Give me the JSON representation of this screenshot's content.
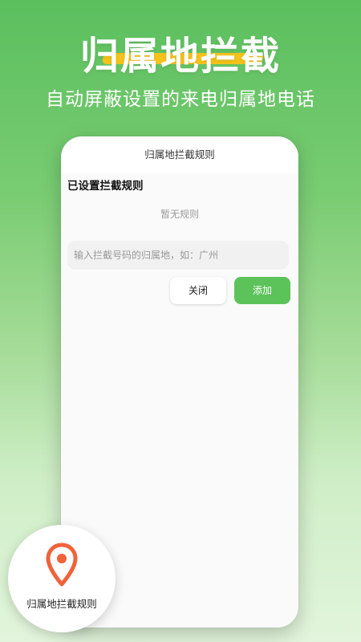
{
  "hero": {
    "title": "归属地拦截",
    "subtitle": "自动屏蔽设置的来电归属地电话"
  },
  "dialog": {
    "header_title": "归属地拦截规则",
    "section_title": "已设置拦截规则",
    "empty_text": "暂无规则",
    "input_placeholder": "输入拦截号码的归属地，如：广州",
    "input_value": "",
    "close_label": "关闭",
    "add_label": "添加"
  },
  "badge": {
    "label": "归属地拦截规则",
    "icon": "location-pin-icon"
  },
  "colors": {
    "accent_green": "#5cc35a",
    "highlight_yellow": "#f4c21a",
    "pin_orange": "#f0623a"
  }
}
